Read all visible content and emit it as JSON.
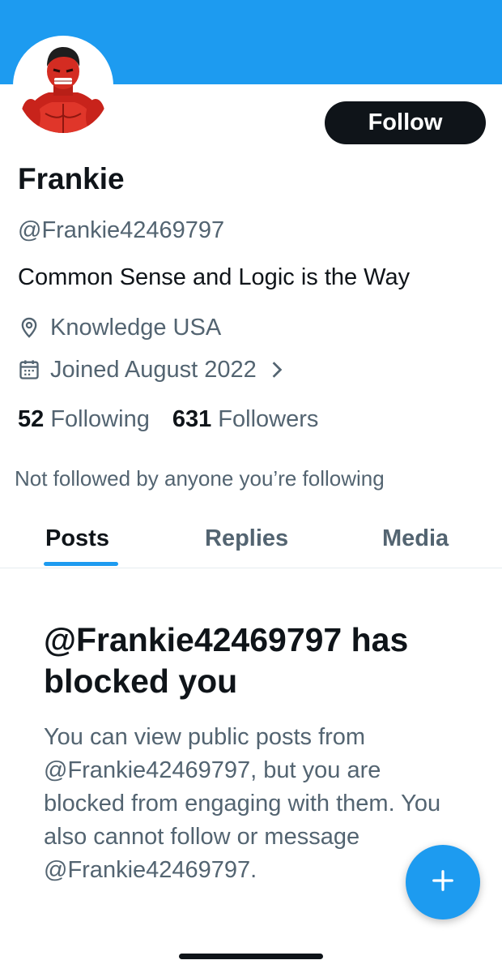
{
  "profile": {
    "name": "Frankie",
    "handle": "@Frankie42469797",
    "bio": "Common Sense and Logic is the Way",
    "location": "Knowledge USA",
    "joined": "Joined August 2022",
    "follow_label": "Follow",
    "following_count": "52",
    "following_label": "Following",
    "followers_count": "631",
    "followers_label": "Followers",
    "not_followed_text": "Not followed by anyone you’re following"
  },
  "tabs": [
    {
      "label": "Posts",
      "active": true
    },
    {
      "label": "Replies",
      "active": false
    },
    {
      "label": "Media",
      "active": false
    }
  ],
  "blocked": {
    "title": "@Frankie42469797 has blocked you",
    "body": "You can view public posts from @Frankie42469797, but you are blocked from engaging with them. You also cannot follow or message @Frankie42469797."
  },
  "fab": {
    "icon": "plus-icon"
  },
  "colors": {
    "accent": "#1d9bf0",
    "text_primary": "#0f1419",
    "text_secondary": "#536471",
    "button_dark": "#0f1419"
  }
}
